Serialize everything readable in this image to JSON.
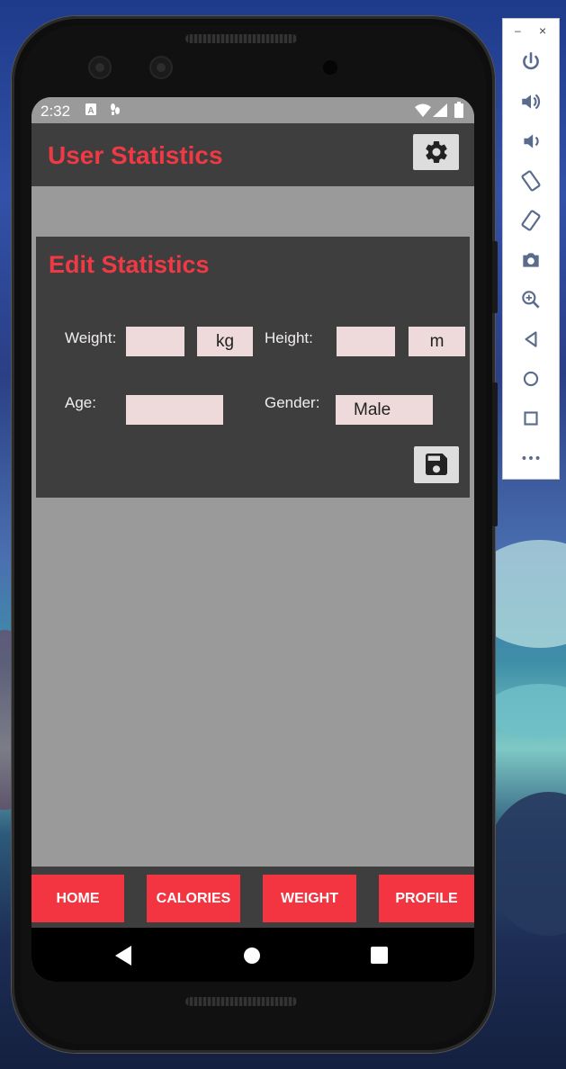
{
  "status_bar": {
    "time": "2:32"
  },
  "app_bar": {
    "title": "User Statistics",
    "settings_icon": "gear-icon"
  },
  "card": {
    "title": "Edit Statistics",
    "weight_label": "Weight:",
    "weight_value": "",
    "weight_unit": "kg",
    "height_label": "Height:",
    "height_value": "",
    "height_unit": "m",
    "age_label": "Age:",
    "age_value": "",
    "gender_label": "Gender:",
    "gender_value": "Male",
    "save_icon": "floppy-disk-icon"
  },
  "bottom_nav": {
    "items": [
      {
        "label": "HOME"
      },
      {
        "label": "CALORIES"
      },
      {
        "label": "WEIGHT"
      },
      {
        "label": "PROFILE"
      }
    ]
  },
  "system_nav": {
    "back": "back-triangle-icon",
    "home": "home-circle-icon",
    "recents": "recents-square-icon"
  },
  "emulator_toolbar": {
    "minimize": "–",
    "close": "×",
    "tools": [
      "power-icon",
      "volume-up-icon",
      "volume-down-icon",
      "rotate-left-icon",
      "rotate-right-icon",
      "camera-icon",
      "zoom-icon",
      "back-icon",
      "home-icon",
      "overview-icon",
      "more-icon"
    ]
  },
  "colors": {
    "accent": "#ef3a45",
    "button_red": "#f23540",
    "panel": "#3e3e3e",
    "screen_bg": "#9a9a9a",
    "field_bg": "#eedada"
  }
}
